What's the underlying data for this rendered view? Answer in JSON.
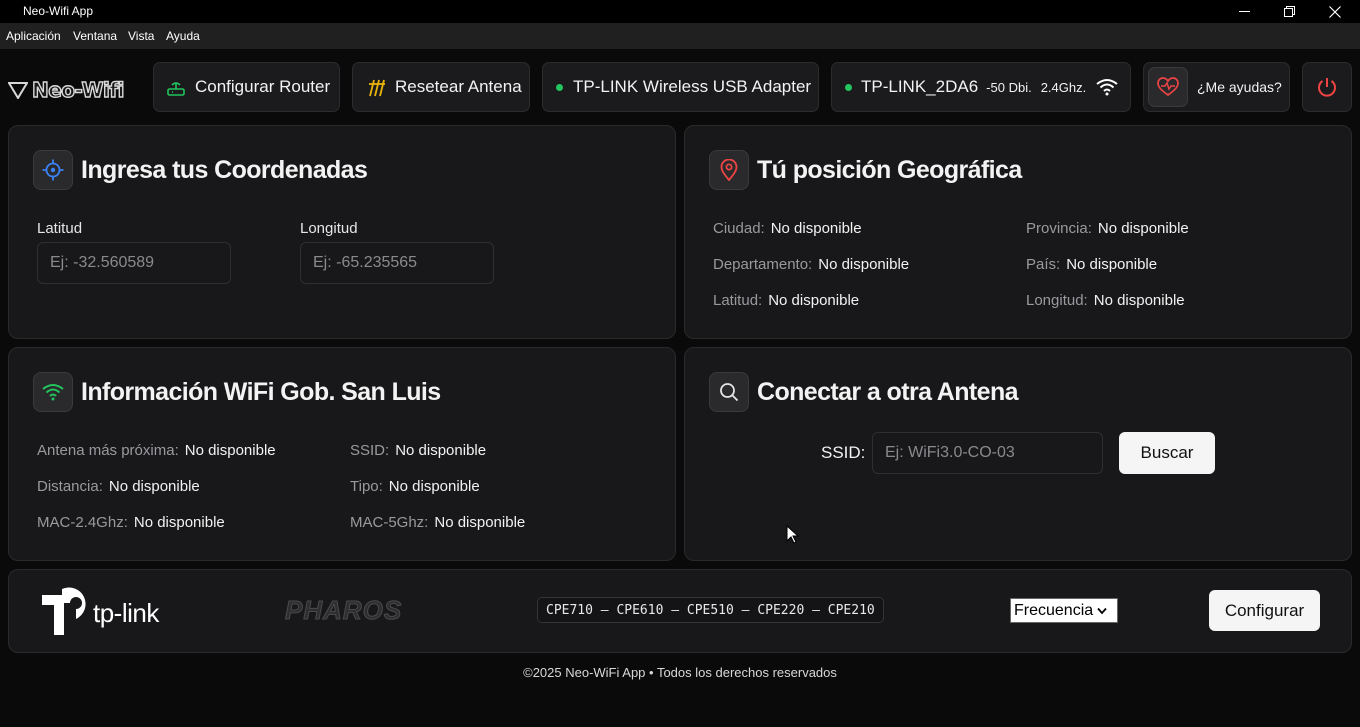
{
  "window": {
    "title": "Neo-Wifi App"
  },
  "menu": [
    "Aplicación",
    "Ventana",
    "Vista",
    "Ayuda"
  ],
  "brand": {
    "logo_text": "Neo-Wifi"
  },
  "toolbar": {
    "configure_router": "Configurar Router",
    "reset_antenna": "Resetear Antena",
    "adapter_name": "TP-LINK Wireless USB Adapter",
    "network_name": "TP-LINK_2DA6",
    "signal": "-50 Dbi.",
    "band": "2.4Ghz.",
    "help": "¿Me ayudas?"
  },
  "coords_card": {
    "title": "Ingresa tus Coordenadas",
    "lat_label": "Latitud",
    "lat_placeholder": "Ej: -32.560589",
    "lon_label": "Longitud",
    "lon_placeholder": "Ej: -65.235565"
  },
  "geo_card": {
    "title": "Tú posición Geográfica",
    "fields": [
      {
        "label": "Ciudad:",
        "value": "No disponible"
      },
      {
        "label": "Provincia:",
        "value": "No disponible"
      },
      {
        "label": "Departamento:",
        "value": "No disponible"
      },
      {
        "label": "País:",
        "value": "No disponible"
      },
      {
        "label": "Latitud:",
        "value": "No disponible"
      },
      {
        "label": "Longitud:",
        "value": "No disponible"
      }
    ]
  },
  "wifi_card": {
    "title": "Información WiFi Gob. San Luis",
    "fields": [
      {
        "label": "Antena más próxima:",
        "value": "No disponible"
      },
      {
        "label": "SSID:",
        "value": "No disponible"
      },
      {
        "label": "Distancia:",
        "value": "No disponible"
      },
      {
        "label": "Tipo:",
        "value": "No disponible"
      },
      {
        "label": "MAC-2.4Ghz:",
        "value": "No disponible"
      },
      {
        "label": "MAC-5Ghz:",
        "value": "No disponible"
      }
    ]
  },
  "connect_card": {
    "title": "Conectar a otra Antena",
    "ssid_label": "SSID:",
    "ssid_placeholder": "Ej: WiFi3.0-CO-03",
    "search_button": "Buscar"
  },
  "bottom": {
    "tplink_text": "tp-link",
    "pharos_text": "PHAROS",
    "models": "CPE710 – CPE610 – CPE510 – CPE220 – CPE210",
    "frequency_select": "Frecuencia",
    "configure_button": "Configurar"
  },
  "footer": "©2025 Neo-WiFi App • Todos los derechos reservados",
  "colors": {
    "accent_green": "#22c55e",
    "accent_blue": "#3b82f6",
    "accent_red": "#ef4444",
    "accent_yellow": "#eab308"
  }
}
